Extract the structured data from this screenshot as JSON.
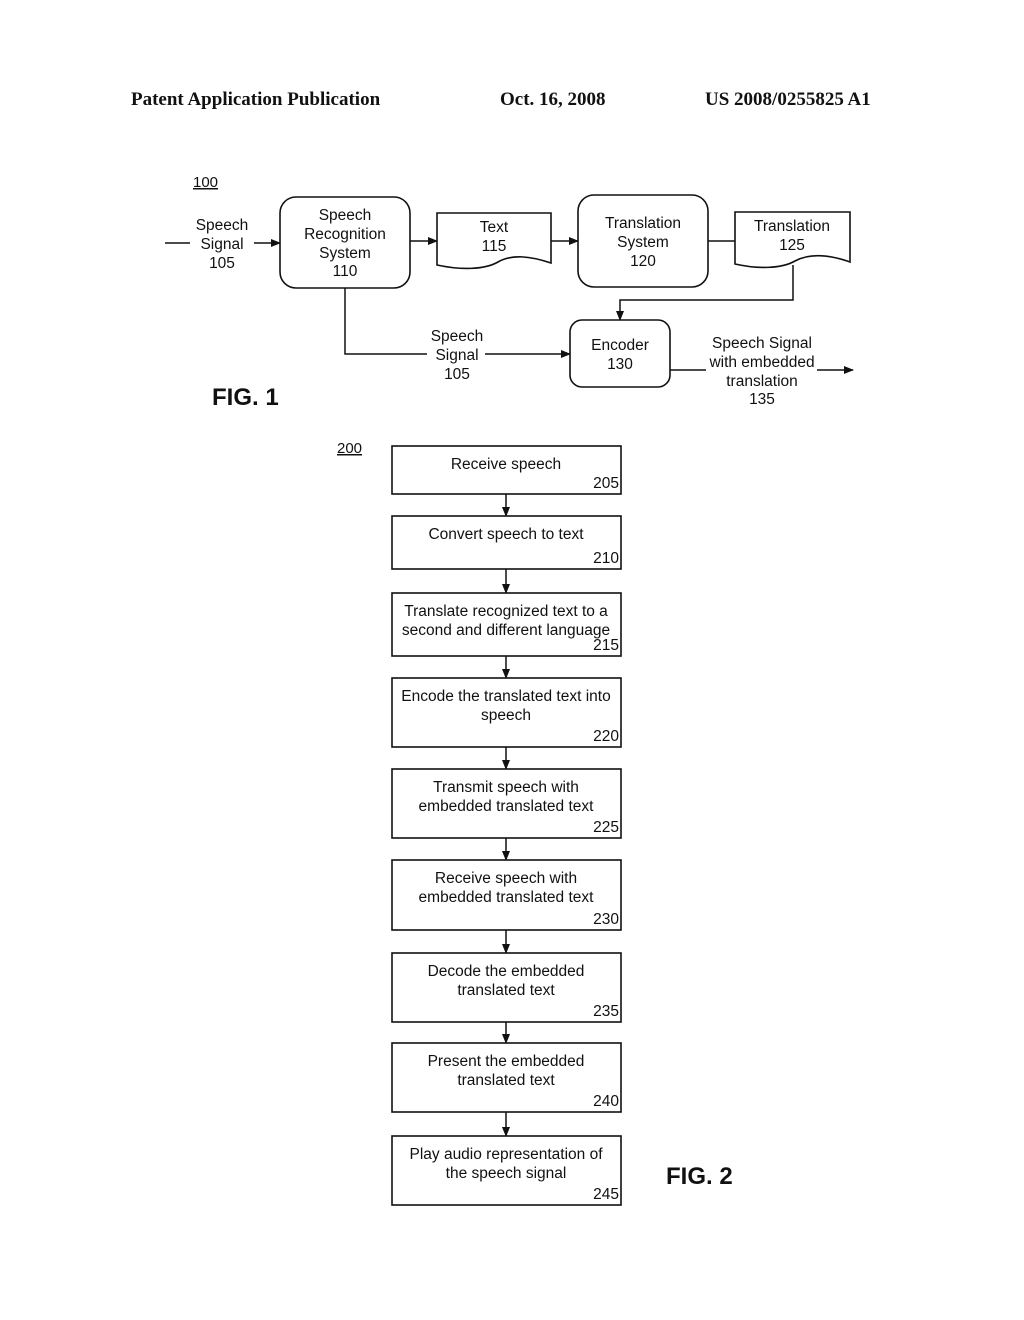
{
  "header": {
    "left": "Patent Application Publication",
    "date": "Oct. 16, 2008",
    "number": "US 2008/0255825 A1"
  },
  "fig1": {
    "ref": "100",
    "caption": "FIG. 1",
    "input_signal": [
      "Speech",
      "Signal",
      "105"
    ],
    "speech_recognition": [
      "Speech",
      "Recognition",
      "System",
      "110"
    ],
    "text": [
      "Text",
      "115"
    ],
    "translation_system": [
      "Translation",
      "System",
      "120"
    ],
    "translation": [
      "Translation",
      "125"
    ],
    "branch_signal": [
      "Speech",
      "Signal",
      "105"
    ],
    "encoder": [
      "Encoder",
      "130"
    ],
    "output_signal": [
      "Speech Signal",
      "with embedded",
      "translation",
      "135"
    ]
  },
  "fig2": {
    "ref": "200",
    "caption": "FIG. 2",
    "steps": [
      {
        "lines": [
          "Receive speech"
        ],
        "num": "205"
      },
      {
        "lines": [
          "Convert speech to text"
        ],
        "num": "210"
      },
      {
        "lines": [
          "Translate recognized text to a",
          "second and different language"
        ],
        "num": "215"
      },
      {
        "lines": [
          "Encode the translated text into",
          "speech"
        ],
        "num": "220"
      },
      {
        "lines": [
          "Transmit speech with",
          "embedded translated text"
        ],
        "num": "225"
      },
      {
        "lines": [
          "Receive speech with",
          "embedded translated text"
        ],
        "num": "230"
      },
      {
        "lines": [
          "Decode the embedded",
          "translated text"
        ],
        "num": "235"
      },
      {
        "lines": [
          "Present the embedded",
          "translated text"
        ],
        "num": "240"
      },
      {
        "lines": [
          "Play audio representation of",
          "the speech signal"
        ],
        "num": "245"
      }
    ]
  }
}
